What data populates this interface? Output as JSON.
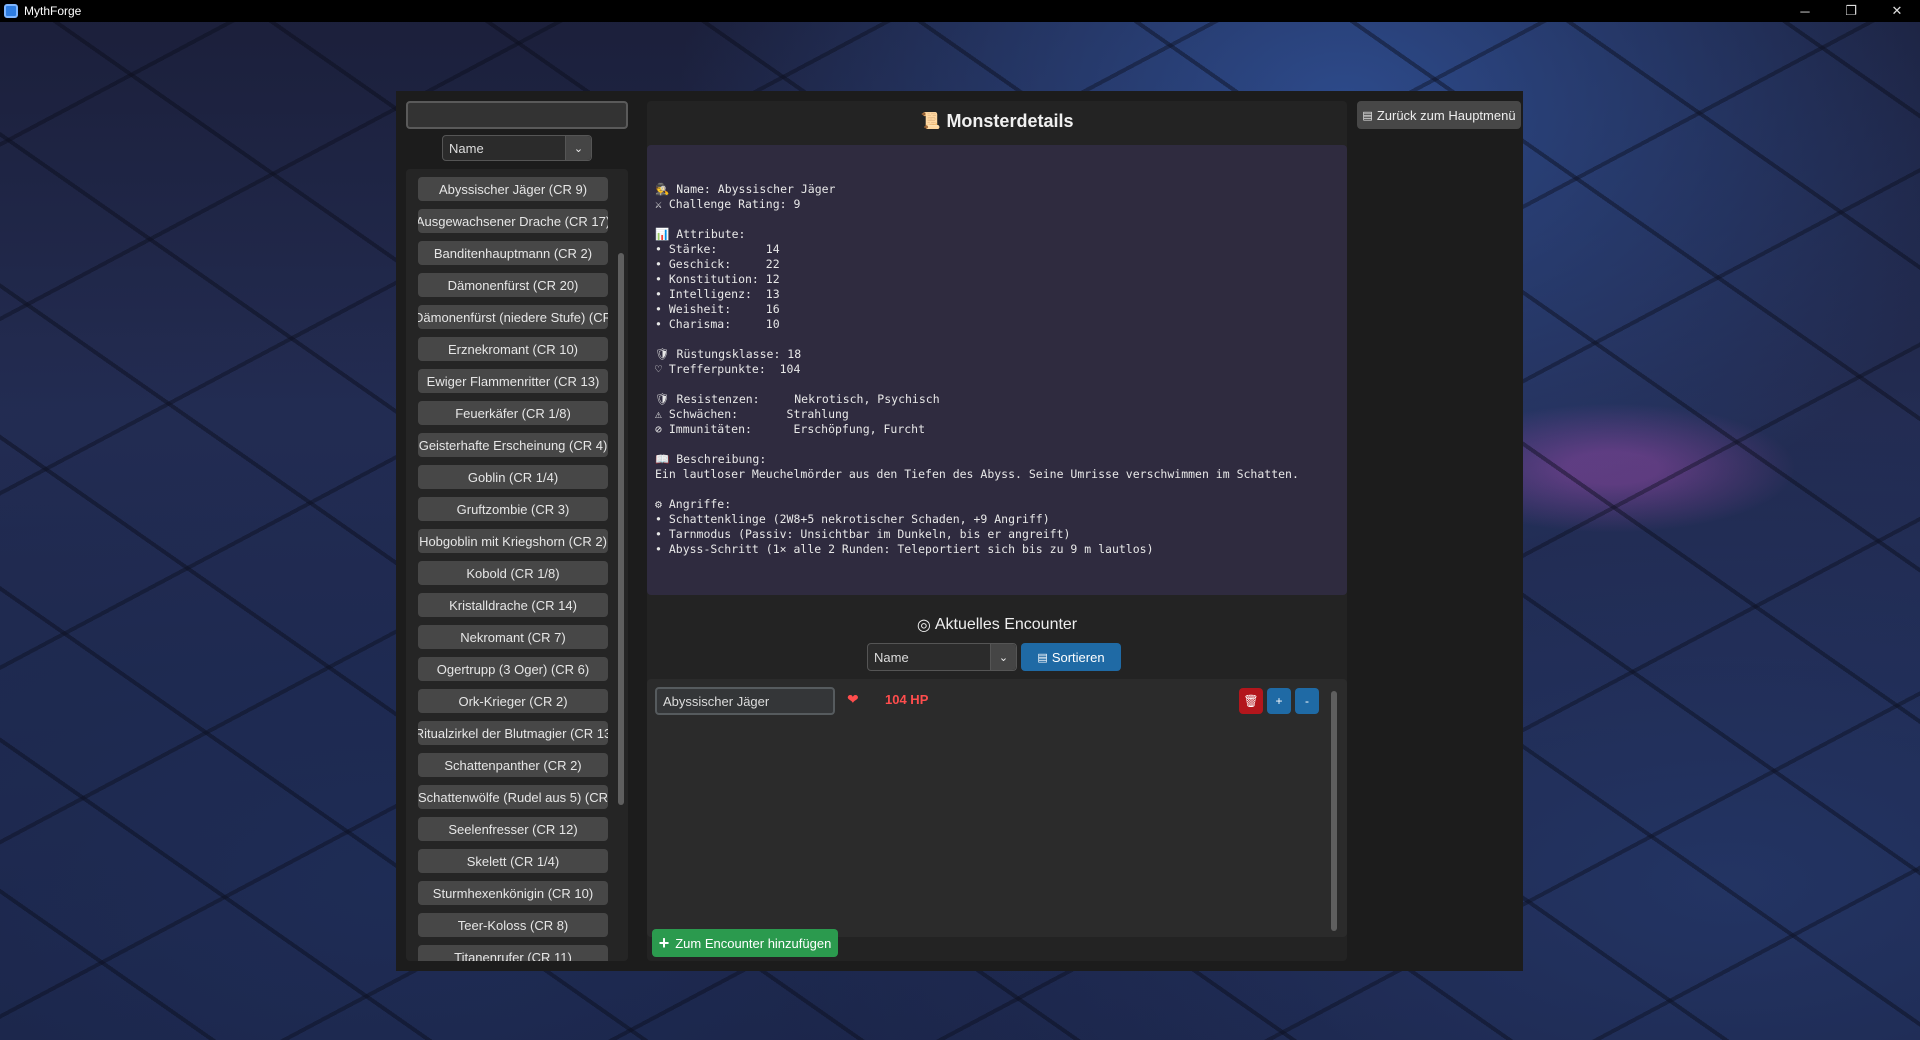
{
  "window": {
    "title": "MythForge",
    "controls": {
      "minimize": "─",
      "restore": "❐",
      "close": "✕"
    }
  },
  "search": {
    "value": "",
    "placeholder": ""
  },
  "list_sort": {
    "selected": "Name"
  },
  "monsters": [
    "Abyssischer Jäger (CR 9)",
    "Ausgewachsener Drache (CR 17)",
    "Banditenhauptmann (CR 2)",
    "Dämonenfürst (CR 20)",
    "Dämonenfürst (niedere Stufe) (CR",
    "Erznekromant (CR 10)",
    "Ewiger Flammenritter (CR 13)",
    "Feuerkäfer (CR 1/8)",
    "Geisterhafte Erscheinung (CR 4)",
    "Goblin (CR 1/4)",
    "Gruftzombie (CR 3)",
    "Hobgoblin mit Kriegshorn (CR 2)",
    "Kobold (CR 1/8)",
    "Kristalldrache (CR 14)",
    "Nekromant (CR 7)",
    "Ogertrupp (3 Oger) (CR 6)",
    "Ork-Krieger (CR 2)",
    "Ritualzirkel der Blutmagier (CR 13",
    "Schattenpanther (CR 2)",
    "Schattenwölfe (Rudel aus 5) (CR",
    "Seelenfresser (CR 12)",
    "Skelett (CR 1/4)",
    "Sturmhexenkönigin (CR 10)",
    "Teer-Koloss (CR 8)",
    "Titanenrufer (CR 11)"
  ],
  "details": {
    "icon": "scroll-icon",
    "title": "Monsterdetails",
    "lines": [
      "",
      "🕵 Name: Abyssischer Jäger",
      "⚔ Challenge Rating: 9",
      "",
      "📊 Attribute:",
      "• Stärke:       14",
      "• Geschick:     22",
      "• Konstitution: 12",
      "• Intelligenz:  13",
      "• Weisheit:     16",
      "• Charisma:     10",
      "",
      "🛡 Rüstungsklasse: 18",
      "♡ Trefferpunkte:  104",
      "",
      "🛡 Resistenzen:     Nekrotisch, Psychisch",
      "⚠ Schwächen:       Strahlung",
      "⊘ Immunitäten:      Erschöpfung, Furcht",
      "",
      "📖 Beschreibung:",
      "Ein lautloser Meuchelmörder aus den Tiefen des Abyss. Seine Umrisse verschwimmen im Schatten.",
      "",
      "⚙ Angriffe:",
      "• Schattenklinge (2W8+5 nekrotischer Schaden, +9 Angriff)",
      "• Tarnmodus (Passiv: Unsichtbar im Dunkeln, bis er angreift)",
      "• Abyss-Schritt (1× alle 2 Runden: Teleportiert sich bis zu 9 m lautlos)"
    ]
  },
  "encounter": {
    "icon": "target-icon",
    "title": "Aktuelles Encounter",
    "sort_selected": "Name",
    "sort_button": "Sortieren",
    "entries": [
      {
        "name": "Abyssischer Jäger",
        "hp": "104 HP",
        "delete": "🗑",
        "plus": "+",
        "minus": "-"
      }
    ],
    "add_button": "Zum Encounter hinzufügen"
  },
  "back_button": "Zurück zum Hauptmenü"
}
